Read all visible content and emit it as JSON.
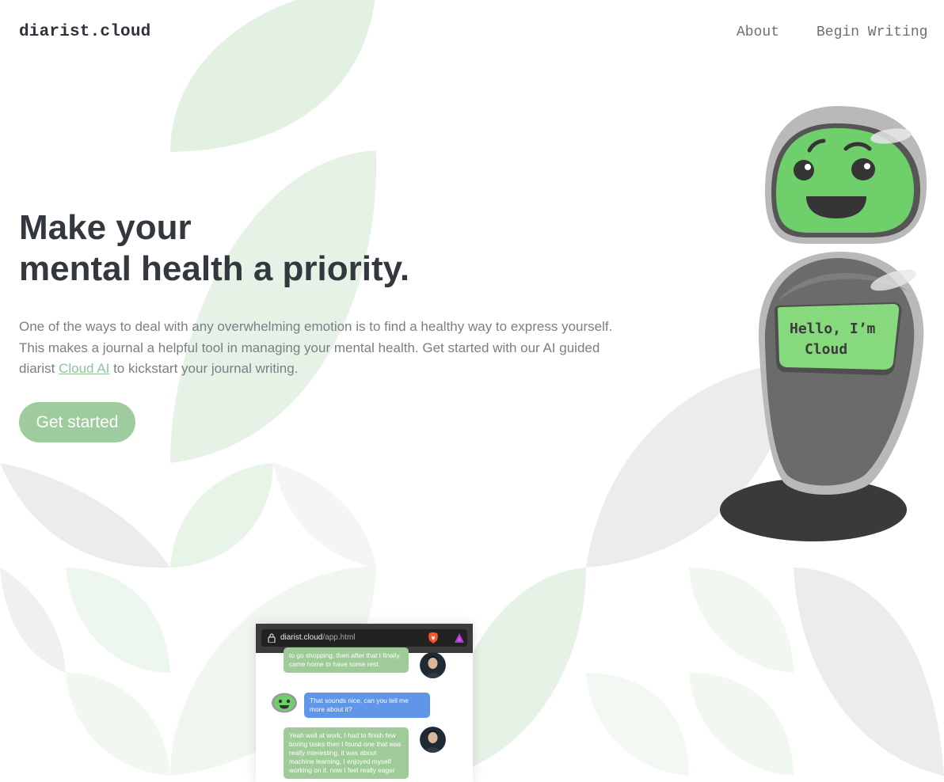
{
  "nav": {
    "brand": "diarist.cloud",
    "about": "About",
    "begin_writing": "Begin Writing"
  },
  "hero": {
    "title_line1": "Make your",
    "title_line2": "mental health a priority.",
    "desc_before": "One of the ways to deal with any overwhelming emotion is to find a healthy way to express yourself. This makes a journal a helpful tool in managing your mental health. Get started with our AI guided diarist ",
    "desc_link": "Cloud AI",
    "desc_after": " to kickstart your journal writing.",
    "cta": "Get started"
  },
  "robot": {
    "screen_line1": "Hello, I’m",
    "screen_line2": "Cloud"
  },
  "preview": {
    "url_domain": "diarist.cloud",
    "url_path": "/app.html",
    "messages": [
      {
        "from": "user",
        "text": "to go shopping, then after that I finally came home to have some rest."
      },
      {
        "from": "bot",
        "text": "That sounds nice, can you tell me more about it?"
      },
      {
        "from": "user",
        "text": "Yeah well at work, I had to finish few boring tasks then I found one that was really interesting, it was about machine learning, I enjoyed myself working on it, now I feel really eager"
      }
    ]
  },
  "colors": {
    "accent_green": "#9fcc9f",
    "link_green": "#8fc49a",
    "heading": "#33383f",
    "body_text": "#7a7f86",
    "robot_face": "#6fcf6a",
    "robot_body": "#6a6a6a"
  },
  "icons": [
    "lock-icon",
    "brave-browser-icon",
    "rewards-triangle-icon"
  ]
}
